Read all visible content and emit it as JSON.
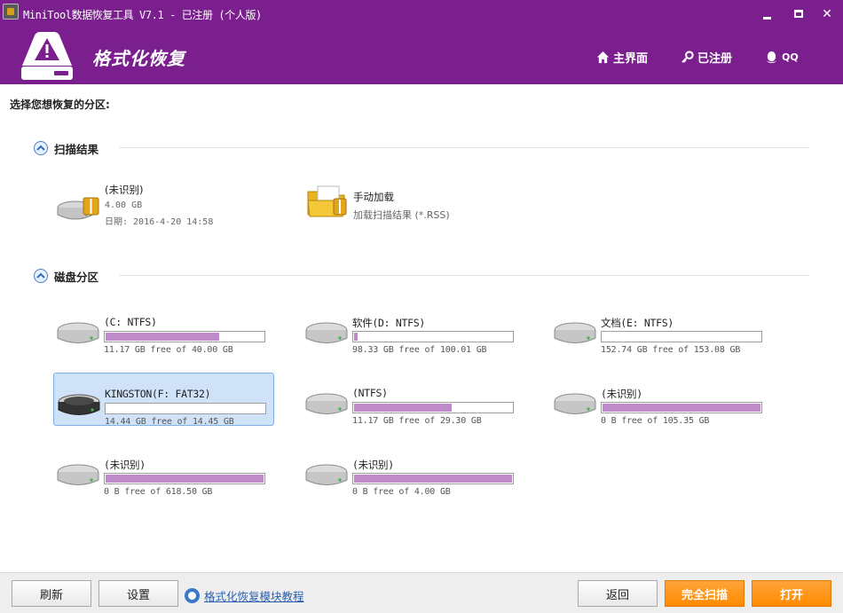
{
  "window": {
    "title": "MiniTool数据恢复工具 V7.1 - 已注册 (个人版)",
    "minimize_icon": "minimize-icon",
    "maximize_icon": "maximize-icon",
    "close_glyph": "✕"
  },
  "header": {
    "title": "格式化恢复",
    "nav": {
      "home": "主界面",
      "registered": "已注册",
      "qq": "QQ"
    }
  },
  "prompt": "选择您想恢复的分区:",
  "sections": {
    "scan_results": {
      "label": "扫描结果",
      "items": [
        {
          "name": "(未识别)",
          "size": "4.00 GB",
          "date": "日期: 2016-4-20 14:58"
        },
        {
          "name": "手动加载",
          "desc": "加载扫描结果 (*.RSS)"
        }
      ]
    },
    "disk_partitions": {
      "label": "磁盘分区",
      "drives": [
        {
          "name": "(C: NTFS)",
          "free": "11.17 GB free of 40.00 GB",
          "used_fraction": 0.72
        },
        {
          "name": "软件(D: NTFS)",
          "free": "98.33 GB free of 100.01 GB",
          "used_fraction": 0.02
        },
        {
          "name": "文档(E: NTFS)",
          "free": "152.74 GB free of 153.08 GB",
          "used_fraction": 0.0
        },
        {
          "name": "KINGSTON(F: FAT32)",
          "free": "14.44 GB free of 14.45 GB",
          "used_fraction": 0.0,
          "selected": true
        },
        {
          "name": "(NTFS)",
          "free": "11.17 GB free of 29.30 GB",
          "used_fraction": 0.62
        },
        {
          "name": "(未识别)",
          "free": "0 B free of 105.35 GB",
          "used_fraction": 1.0
        },
        {
          "name": "(未识别)",
          "free": "0 B free of 618.50 GB",
          "used_fraction": 1.0
        },
        {
          "name": "(未识别)",
          "free": "0 B free of 4.00 GB",
          "used_fraction": 1.0
        }
      ]
    }
  },
  "footer": {
    "refresh": "刷新",
    "settings": "设置",
    "tutorial": "格式化恢复模块教程",
    "back": "返回",
    "full_scan": "完全扫描",
    "open": "打开"
  },
  "colors": {
    "brand_purple": "#7b1f8f",
    "bar_fill": "#bf8ac8",
    "orange": "#ff8a00",
    "selection": "#cfe2f7"
  }
}
